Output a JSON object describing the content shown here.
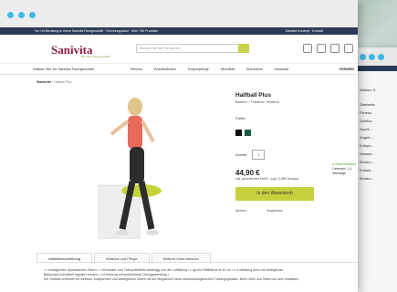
{
  "colors": {
    "accent": "#c8cf3e",
    "brand": "#8c1f45",
    "nav_bg": "#2c3b57"
  },
  "topbar": {
    "left": "Vor Ort Beratung in Ihrem Sanivita Fachgeschäft · Rechnungskauf · Über 750 Produkte",
    "right": "Sanivita Konzept · Kontakt"
  },
  "logo": {
    "name": "Sanivita",
    "tagline": "für mehr Lebensqualität"
  },
  "search": {
    "placeholder": "Wonach Sie hier Sie suchen..."
  },
  "nav": {
    "branch": "Wählen Sie Ihr Sanivita Fachgeschäft",
    "items": [
      "Fitness",
      "Wohlbefinden",
      "Körperpflege",
      "Mobilität",
      "Sicherheit",
      "Haushalt"
    ],
    "theme": "THEMEN"
  },
  "breadcrumb": {
    "root": "Startseite",
    "current": "Halfball Plus"
  },
  "product": {
    "title": "Halfball Plus",
    "subtitle": "Balance- / Trainierer / Bestbezi",
    "color_label": "Farbe:",
    "colors": [
      "#111111",
      "#1c5a3f"
    ],
    "qty_label": "Anzahl:",
    "qty": "1",
    "price": "44,90 €",
    "tax": "inkl. gesetzlicher MwSt., zzgl. 5,95€ Versand",
    "cart": "In den Warenkorb",
    "wishlist": "Merken",
    "compare": "Vergleichen",
    "availability": "● Sofort lieferbar",
    "delivery": "Lieferzeit: 1-3 Werktage"
  },
  "tabs": [
    "Artikelbeschreibung",
    "Material und Pflege",
    "Weitere Informationen"
  ],
  "description": [
    ">> bewegliches, dynamisches Sitzen • >>Schaukel- und Trampolineffekt abhängig von der Luftfüllung • >>große Stellfläche Ø 40 cm • >>Luftfüllung kann mit beiliegender",
    "Ballpumpe individuell reguliert werden • >>Lieferung mit ausführlicher Übungsanleitung •",
    "Der Halfball verbindet ein weiches, entspanntes und bewegliches Sitzen mit der Möglichkeit eines abwechslungsreichen Trainingsgerätes. Beim Üben und Sitzen auf dem Instabilen"
  ],
  "back_window": {
    "top": "Vor Ort",
    "branch": "Wählen S",
    "list": [
      "Startseite",
      "Fitness",
      "Sanftes",
      "Sporti...",
      "Angeb...",
      "Entspa...",
      "Wasser...",
      "Blutdru...",
      "Entlast...",
      "Blutdru..."
    ]
  }
}
